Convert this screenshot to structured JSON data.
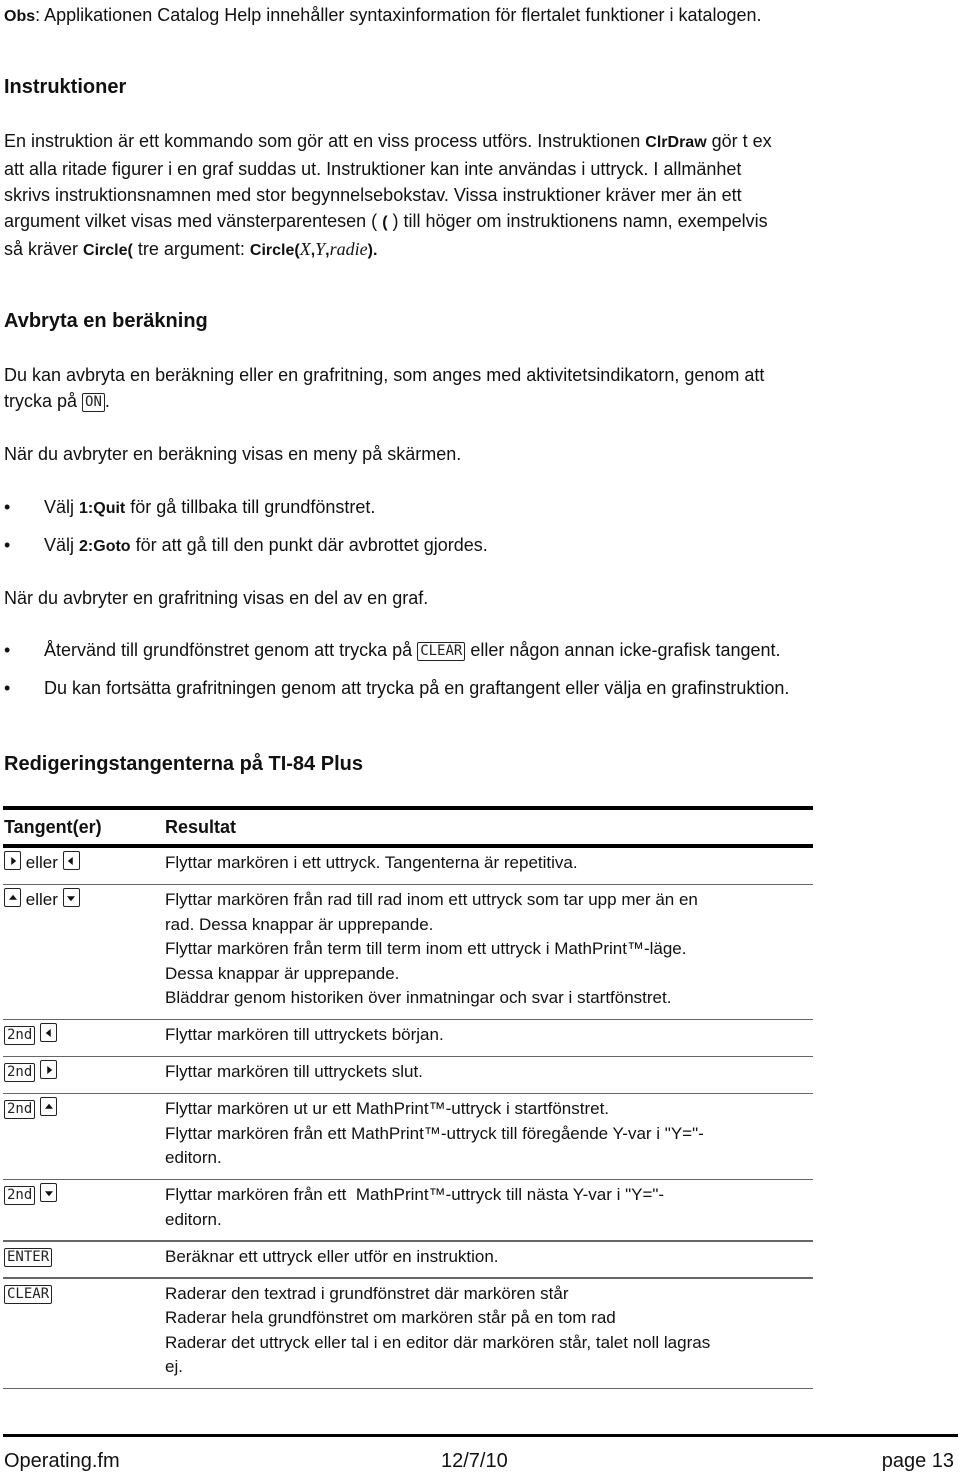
{
  "note": {
    "label": "Obs",
    "text": ": Applikationen Catalog Help innehåller syntaxinformation för flertalet funktioner i katalogen."
  },
  "section_instruktioner": {
    "heading": "Instruktioner",
    "line1_a": "En instruktion är ett kommando som gör att en viss process utförs. Instruktionen ",
    "line1_cmd": "ClrDraw",
    "line1_b": " gör t ex",
    "line2": "att alla ritade figurer i en graf suddas ut. Instruktioner kan inte användas i uttryck. I allmänhet",
    "line3": "skrivs instruktionsnamnen med stor begynnelsebokstav. Vissa instruktioner kräver mer än ett",
    "line4_a": "argument vilket visas med vänsterparentesen ( ",
    "line4_paren": "(",
    "line4_b": " ) till höger om instruktionens namn, exempelvis",
    "line5_a": "så kräver ",
    "line5_cmd1": "Circle(",
    "line5_b": " tre argument: ",
    "line5_cmd2": "Circle(",
    "line5_x": "X",
    "line5_comma1": ",",
    "line5_y": "Y",
    "line5_comma2": ",",
    "line5_radie": "radie",
    "line5_close": ").",
    "line5_end": ""
  },
  "section_avbryta": {
    "heading": "Avbryta en beräkning",
    "para1_line1": "Du kan avbryta en beräkning eller en grafritning, som anges med aktivitetsindikatorn, genom att",
    "para1_line2_a": "trycka på ",
    "para1_key": "ON",
    "para1_line2_b": ".",
    "para2": "När du avbryter en beräkning visas en meny på skärmen.",
    "bullets1": [
      {
        "pre": "Välj ",
        "cmd": "1:Quit",
        "post": " för gå tillbaka till grundfönstret."
      },
      {
        "pre": "Välj ",
        "cmd": "2:Goto",
        "post": " för att gå till den punkt där avbrottet gjordes."
      }
    ],
    "para3": "När du avbryter en grafritning visas en del av en graf.",
    "bullets2": [
      {
        "pre": "Återvänd till grundfönstret genom att trycka på ",
        "key": "CLEAR",
        "post": " eller någon annan icke-grafisk tangent."
      },
      {
        "pre": "Du kan fortsätta grafritningen genom att trycka på en graftangent eller välja en grafinstruktion.",
        "key": "",
        "post": ""
      }
    ],
    "bullet_char": "•"
  },
  "section_redigering": {
    "heading": "Redigeringstangenterna på TI-84 Plus",
    "table": {
      "headers": [
        "Tangent(er)",
        "Resultat"
      ],
      "eller": "eller",
      "rows": [
        {
          "keys": "right-arrow eller left-arrow",
          "result": [
            "Flyttar markören i ett uttryck. Tangenterna är repetitiva."
          ]
        },
        {
          "keys": "up-arrow eller down-arrow",
          "result": [
            "Flyttar markören från rad till rad inom ett uttryck som tar upp mer än en",
            "rad. Dessa knappar är upprepande.",
            "Flyttar markören från term till term inom ett uttryck i MathPrint™-läge.",
            "Dessa knappar är upprepande.",
            "Bläddrar genom historiken över inmatningar och svar i startfönstret."
          ]
        },
        {
          "keys": "2nd left-arrow",
          "key_label": "2nd",
          "result": [
            "Flyttar markören till uttryckets början."
          ]
        },
        {
          "keys": "2nd right-arrow",
          "key_label": "2nd",
          "result": [
            "Flyttar markören till uttryckets slut."
          ]
        },
        {
          "keys": "2nd up-arrow",
          "key_label": "2nd",
          "result": [
            "Flyttar markören ut ur ett MathPrint™-uttryck i startfönstret.",
            "Flyttar markören från ett MathPrint™-uttryck till föregående Y-var i \"Y=\"-",
            "editorn."
          ]
        },
        {
          "keys": "2nd down-arrow",
          "key_label": "2nd",
          "result": [
            "Flyttar markören från ett  MathPrint™-uttryck till nästa Y-var i \"Y=\"-",
            "editorn."
          ]
        },
        {
          "keys": "ENTER",
          "key_label": "ENTER",
          "result": [
            "Beräknar ett uttryck eller utför en instruktion."
          ]
        },
        {
          "keys": "CLEAR",
          "key_label": "CLEAR",
          "result": [
            "Raderar den textrad i grundfönstret där markören står",
            "Raderar hela grundfönstret om markören står på en tom rad",
            "Raderar det uttryck eller tal i en editor där markören står, talet noll lagras",
            "ej."
          ]
        }
      ]
    }
  },
  "footer": {
    "file": "Operating.fm",
    "date": "12/7/10",
    "page": "page 13"
  }
}
